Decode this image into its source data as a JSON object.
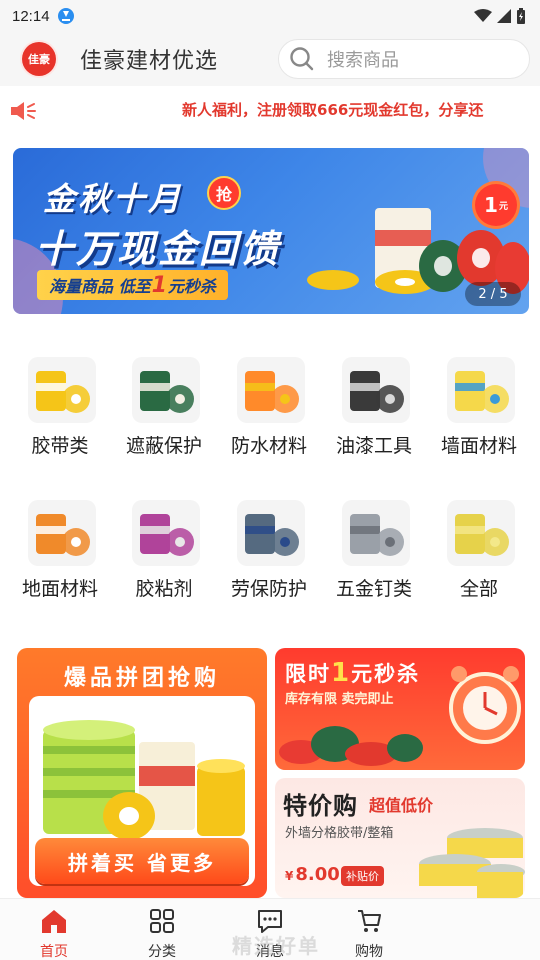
{
  "status_bar": {
    "time": "12:14"
  },
  "header": {
    "logo_text": "佳豪",
    "title": "佳豪建材优选",
    "search_placeholder": "搜索商品"
  },
  "notice": {
    "text": "新人福利，注册领取666元现金红包，分享还"
  },
  "banner": {
    "line1": "金秋十月",
    "badge": "抢",
    "line2": "十万现金回馈",
    "strip_pre": "海量商品 低至",
    "strip_num": "1",
    "strip_post": "元秒杀",
    "price_num": "1",
    "price_unit": "元",
    "pager": "2 / 5"
  },
  "categories": [
    {
      "label": "胶带类",
      "icon": "tape-icon"
    },
    {
      "label": "遮蔽保护",
      "icon": "masking-film-icon"
    },
    {
      "label": "防水材料",
      "icon": "waterproof-icon"
    },
    {
      "label": "油漆工具",
      "icon": "paint-tools-icon"
    },
    {
      "label": "墙面材料",
      "icon": "wall-material-icon"
    },
    {
      "label": "地面材料",
      "icon": "floor-material-icon"
    },
    {
      "label": "胶粘剂",
      "icon": "adhesive-icon"
    },
    {
      "label": "劳保防护",
      "icon": "safety-gear-icon"
    },
    {
      "label": "五金钉类",
      "icon": "hardware-icon"
    },
    {
      "label": "全部",
      "icon": "all-icon"
    }
  ],
  "promo_group": {
    "title": "爆品拼团抢购",
    "button": "拼着买 省更多"
  },
  "promo_flash": {
    "title_pre": "限时",
    "title_num": "1",
    "title_post": "元秒杀",
    "subtitle": "库存有限 卖完即止"
  },
  "promo_special": {
    "title": "特价购",
    "tag": "超值低价",
    "desc": "外墙分格胶带/整箱",
    "currency": "¥",
    "price": "8.00",
    "badge": "补贴价"
  },
  "bottom_nav": [
    {
      "label": "首页",
      "icon": "home-icon",
      "active": true
    },
    {
      "label": "分类",
      "icon": "grid-icon",
      "active": false
    },
    {
      "label": "消息",
      "icon": "message-icon",
      "active": false
    },
    {
      "label": "购物",
      "icon": "cart-icon",
      "active": false
    }
  ],
  "bottom_ghost": "精选好单",
  "colors": {
    "accent": "#e2392e",
    "banner_blue": "#2a6bd8",
    "promo_orange": "#ff6a2a"
  }
}
